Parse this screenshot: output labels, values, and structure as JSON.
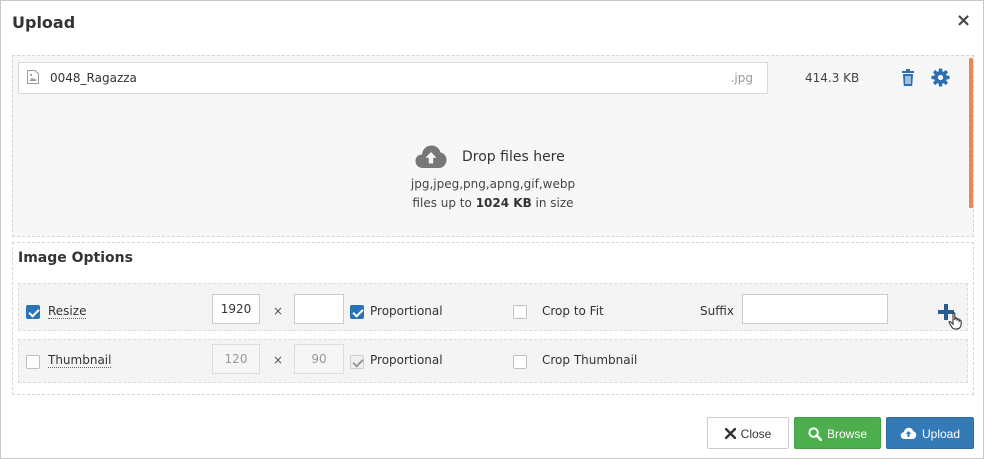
{
  "dialog": {
    "title": "Upload"
  },
  "file": {
    "name": "0048_Ragazza",
    "extension": ".jpg",
    "size": "414.3 KB"
  },
  "drop_zone": {
    "title": "Drop files here",
    "types": "jpg,jpeg,png,apng,gif,webp",
    "limit_prefix": "files up to",
    "limit_value": "1024 KB",
    "limit_suffix": "in size"
  },
  "options": {
    "title": "Image Options",
    "resize": {
      "label": "Resize",
      "checked": true,
      "width": "1920",
      "height": "",
      "times": "×",
      "proportional_label": "Proportional",
      "proportional_checked": true,
      "crop_label": "Crop to Fit",
      "crop_checked": false,
      "suffix_label": "Suffix",
      "suffix_value": ""
    },
    "thumbnail": {
      "label": "Thumbnail",
      "checked": false,
      "width": "120",
      "height": "90",
      "times": "×",
      "proportional_label": "Proportional",
      "proportional_checked": true,
      "crop_label": "Crop Thumbnail",
      "crop_checked": false
    }
  },
  "footer": {
    "close_label": "Close",
    "browse_label": "Browse",
    "upload_label": "Upload"
  },
  "colors": {
    "primary": "#337ab7",
    "success": "#4cae4c",
    "checkbox": "#2a73b8",
    "scroll_accent": "#e8875a",
    "icon_blue": "#2a6fb0"
  },
  "icons": {
    "dialog_close": "close-icon",
    "file": "file-image-icon",
    "delete": "trash-icon",
    "settings": "gear-icon",
    "drop": "cloud-upload-icon",
    "add": "plus-icon",
    "browse": "search-icon",
    "upload": "cloud-upload-icon",
    "close": "x-icon"
  }
}
